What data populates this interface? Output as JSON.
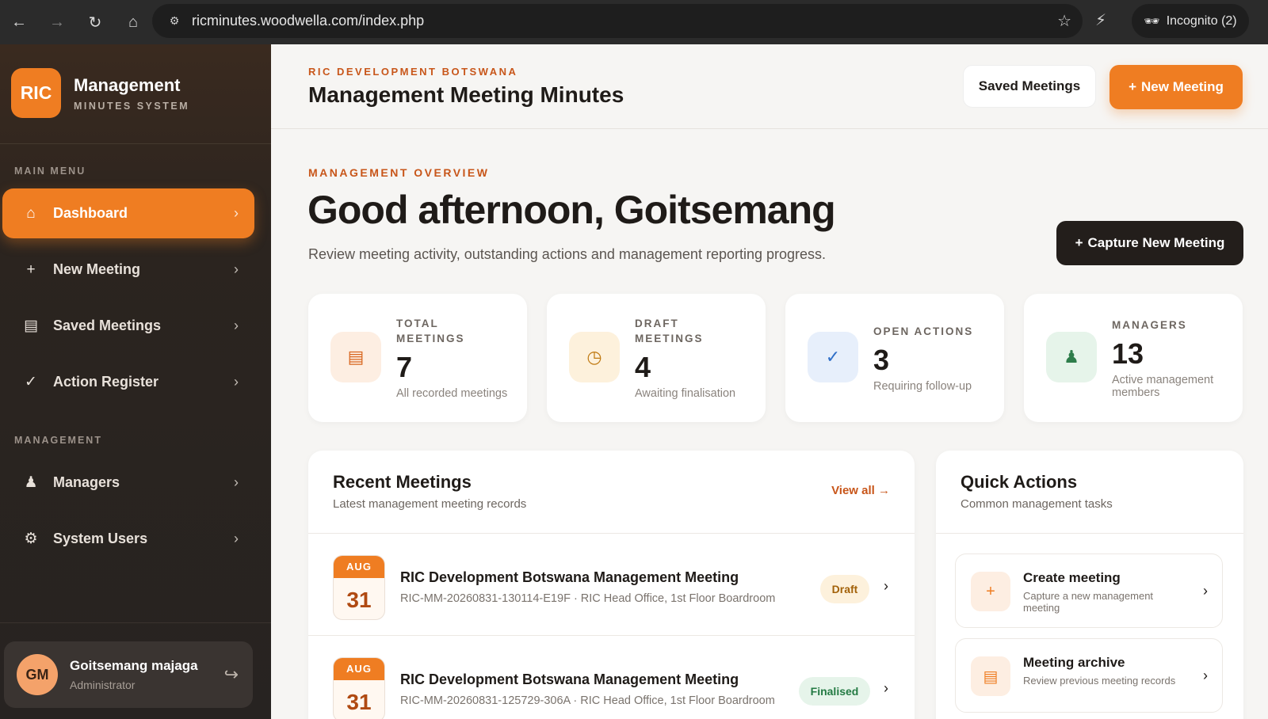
{
  "browser": {
    "url": "ricminutes.woodwella.com/index.php",
    "incognito_label": "Incognito (2)"
  },
  "sidebar": {
    "brand_mark": "RIC",
    "brand_title": "Management",
    "brand_subtitle": "MINUTES SYSTEM",
    "main_menu_label": "MAIN MENU",
    "main_items": [
      {
        "label": "Dashboard",
        "icon": "home-icon",
        "active": true
      },
      {
        "label": "New Meeting",
        "icon": "plus-icon",
        "active": false
      },
      {
        "label": "Saved Meetings",
        "icon": "list-icon",
        "active": false
      },
      {
        "label": "Action Register",
        "icon": "check-icon",
        "active": false
      }
    ],
    "management_label": "MANAGEMENT",
    "management_items": [
      {
        "label": "Managers",
        "icon": "user-icon"
      },
      {
        "label": "System Users",
        "icon": "gear-icon"
      }
    ],
    "user": {
      "initials": "GM",
      "name": "Goitsemang majaga",
      "role": "Administrator"
    }
  },
  "header": {
    "org": "RIC DEVELOPMENT BOTSWANA",
    "title": "Management Meeting Minutes",
    "saved_button": "Saved Meetings",
    "new_button": "New Meeting"
  },
  "overview": {
    "label": "MANAGEMENT OVERVIEW",
    "greeting": "Good afternoon, Goitsemang",
    "subtitle": "Review meeting activity, outstanding actions and management reporting progress.",
    "capture_button": "Capture New Meeting"
  },
  "stats": [
    {
      "label_line1": "TOTAL",
      "label_line2": "MEETINGS",
      "value": "7",
      "desc": "All recorded meetings",
      "icon": "list-icon"
    },
    {
      "label_line1": "DRAFT",
      "label_line2": "MEETINGS",
      "value": "4",
      "desc": "Awaiting finalisation",
      "icon": "clock-icon"
    },
    {
      "label_line1": "OPEN ACTIONS",
      "label_line2": "",
      "value": "3",
      "desc": "Requiring follow-up",
      "icon": "check-icon"
    },
    {
      "label_line1": "MANAGERS",
      "label_line2": "",
      "value": "13",
      "desc": "Active management members",
      "icon": "user-icon"
    }
  ],
  "recent": {
    "title": "Recent Meetings",
    "subtitle": "Latest management meeting records",
    "view_all": "View all →",
    "meetings": [
      {
        "month": "AUG",
        "day": "31",
        "title": "RIC Development Botswana Management Meeting",
        "meta": "RIC-MM-20260831-130114-E19F · RIC Head Office, 1st Floor Boardroom",
        "status": "Draft"
      },
      {
        "month": "AUG",
        "day": "31",
        "title": "RIC Development Botswana Management Meeting",
        "meta": "RIC-MM-20260831-125729-306A · RIC Head Office, 1st Floor Boardroom",
        "status": "Finalised"
      }
    ]
  },
  "quick": {
    "title": "Quick Actions",
    "subtitle": "Common management tasks",
    "items": [
      {
        "title": "Create meeting",
        "desc": "Capture a new management meeting",
        "icon": "plus-icon"
      },
      {
        "title": "Meeting archive",
        "desc": "Review previous meeting records",
        "icon": "list-icon"
      }
    ]
  },
  "colors": {
    "accent": "#ef7d22",
    "accent_text": "#c8561a",
    "sidebar_bg": "#2b241f",
    "dark_button": "#231e1b"
  }
}
